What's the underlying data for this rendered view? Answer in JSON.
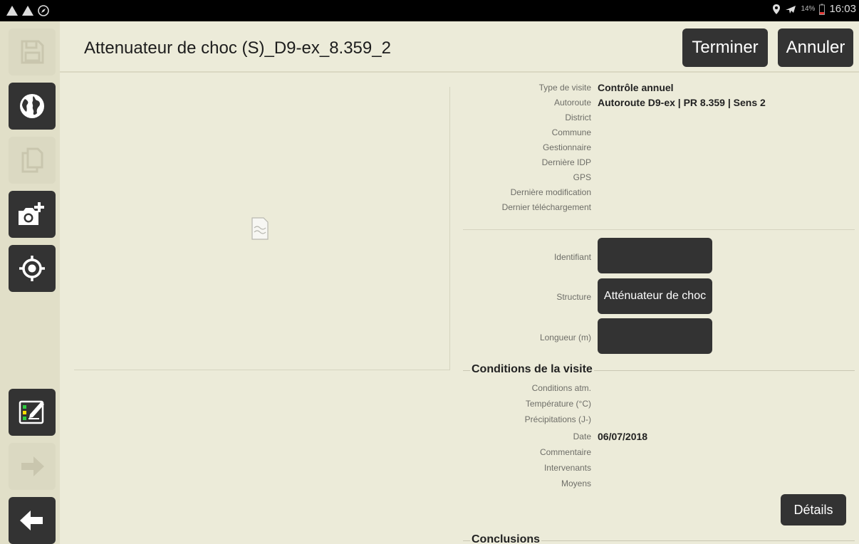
{
  "status_bar": {
    "left_icons": [
      "warning-icon",
      "warning-icon",
      "compass-icon"
    ],
    "battery_pct": "14%",
    "time": "16:03"
  },
  "sidebar": {
    "buttons": [
      "save-icon",
      "globe-icon",
      "copy-icon",
      "add-photo-icon",
      "locate-icon",
      "checklist-icon",
      "arrow-right-icon",
      "arrow-left-icon"
    ]
  },
  "header": {
    "title": "Attenuateur de choc (S)_D9-ex_8.359_2",
    "finish_label": "Terminer",
    "cancel_label": "Annuler"
  },
  "info": {
    "rows": [
      {
        "label": "Type de visite",
        "value": "Contrôle annuel"
      },
      {
        "label": "Autoroute",
        "value": "Autoroute D9-ex | PR 8.359 | Sens 2"
      },
      {
        "label": "District",
        "value": ""
      },
      {
        "label": "Commune",
        "value": ""
      },
      {
        "label": "Gestionnaire",
        "value": ""
      },
      {
        "label": "Dernière IDP",
        "value": ""
      },
      {
        "label": "GPS",
        "value": ""
      },
      {
        "label": "Dernière modification",
        "value": ""
      },
      {
        "label": "Dernier téléchargement",
        "value": ""
      }
    ]
  },
  "fields": {
    "identifiant_label": "Identifiant",
    "identifiant_value": "",
    "structure_label": "Structure",
    "structure_value": "Atténuateur de choc",
    "longueur_label": "Longueur (m)",
    "longueur_value": ""
  },
  "conditions": {
    "title": "Conditions de la visite",
    "rows": [
      {
        "label": "Conditions atm.",
        "value": ""
      },
      {
        "label": "Température (°C)",
        "value": ""
      },
      {
        "label": "Précipitations (J-)",
        "value": ""
      },
      {
        "label": "Date",
        "value": "06/07/2018"
      },
      {
        "label": "Commentaire",
        "value": ""
      },
      {
        "label": "Intervenants",
        "value": ""
      },
      {
        "label": "Moyens",
        "value": ""
      }
    ],
    "details_label": "Détails"
  },
  "conclusions": {
    "title": "Conclusions"
  }
}
